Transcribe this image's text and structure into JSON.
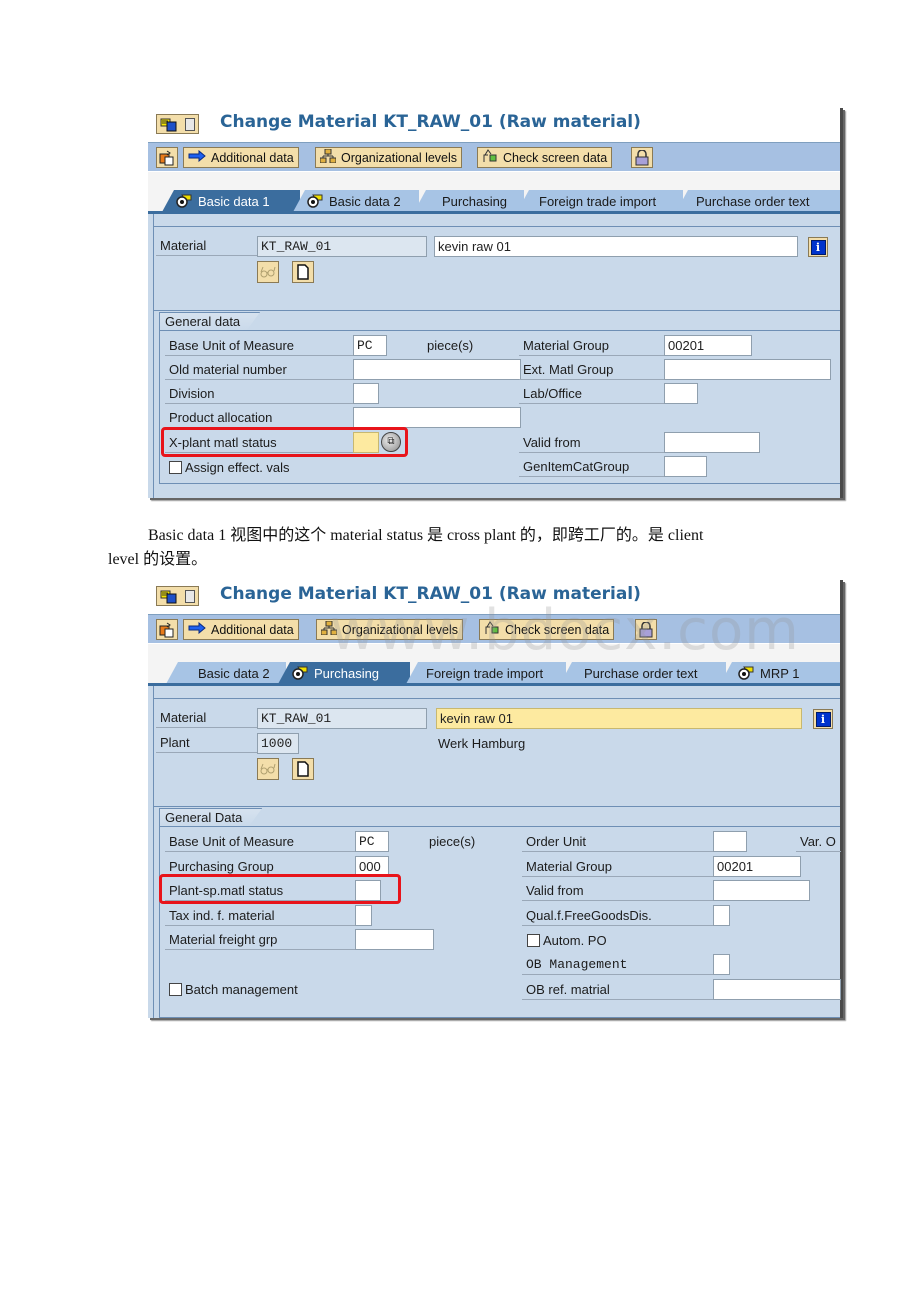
{
  "screenshot1": {
    "title": "Change Material KT_RAW_01 (Raw material)",
    "toolbar": {
      "additional_data": "Additional data",
      "org_levels": "Organizational levels",
      "check_screen_data": "Check screen data"
    },
    "tabs": [
      {
        "label": "Basic data 1",
        "active": true,
        "has_icon": true
      },
      {
        "label": "Basic data 2",
        "active": false,
        "has_icon": true
      },
      {
        "label": "Purchasing",
        "active": false,
        "has_icon": false
      },
      {
        "label": "Foreign trade import",
        "active": false,
        "has_icon": false
      },
      {
        "label": "Purchase order text",
        "active": false,
        "has_icon": false
      }
    ],
    "header": {
      "material_label": "Material",
      "material_value": "KT_RAW_01",
      "description_value": "kevin raw 01"
    },
    "group_title": "General data",
    "left_fields": {
      "base_uom_label": "Base Unit of Measure",
      "base_uom_value": "PC",
      "base_uom_text": "piece(s)",
      "old_material_label": "Old material number",
      "old_material_value": "",
      "division_label": "Division",
      "division_value": "",
      "product_alloc_label": "Product allocation",
      "product_alloc_value": "",
      "xplant_status_label": "X-plant matl status",
      "xplant_status_value": "",
      "assign_effect_label": "Assign effect. vals",
      "assign_effect_checked": false
    },
    "right_fields": {
      "material_group_label": "Material Group",
      "material_group_value": "00201",
      "ext_matl_group_label": "Ext. Matl Group",
      "ext_matl_group_value": "",
      "lab_office_label": "Lab/Office",
      "lab_office_value": "",
      "valid_from_label": "Valid from",
      "valid_from_value": "",
      "gen_item_cat_label": "GenItemCatGroup",
      "gen_item_cat_value": ""
    }
  },
  "paragraph": {
    "line1": "Basic data 1 视图中的这个 material status 是 cross plant 的，即跨工厂的。是 client",
    "line2": "level 的设置。"
  },
  "screenshot2": {
    "title": "Change Material KT_RAW_01 (Raw material)",
    "toolbar": {
      "additional_data": "Additional data",
      "org_levels": "Organizational levels",
      "check_screen_data": "Check screen data"
    },
    "tabs": [
      {
        "label": "Basic data 2",
        "active": false,
        "has_icon": false
      },
      {
        "label": "Purchasing",
        "active": true,
        "has_icon": true
      },
      {
        "label": "Foreign trade import",
        "active": false,
        "has_icon": false
      },
      {
        "label": "Purchase order text",
        "active": false,
        "has_icon": false
      },
      {
        "label": "MRP 1",
        "active": false,
        "has_icon": true
      }
    ],
    "header": {
      "material_label": "Material",
      "material_value": "KT_RAW_01",
      "description_value": "kevin raw 01",
      "plant_label": "Plant",
      "plant_value": "1000",
      "plant_name": "Werk Hamburg"
    },
    "group_title": "General Data",
    "left_fields": {
      "base_uom_label": "Base Unit of Measure",
      "base_uom_value": "PC",
      "base_uom_text": "piece(s)",
      "purch_group_label": "Purchasing Group",
      "purch_group_value": "000",
      "plant_status_label": "Plant-sp.matl status",
      "plant_status_value": "",
      "tax_ind_label": "Tax ind. f. material",
      "tax_ind_value": "",
      "freight_grp_label": "Material freight grp",
      "freight_grp_value": "",
      "batch_mgmt_label": "Batch management",
      "batch_mgmt_checked": false
    },
    "right_fields": {
      "order_unit_label": "Order Unit",
      "order_unit_value": "",
      "var_label": "Var. O",
      "material_group_label": "Material Group",
      "material_group_value": "00201",
      "valid_from_label": "Valid from",
      "valid_from_value": "",
      "qual_free_goods_label": "Qual.f.FreeGoodsDis.",
      "qual_free_goods_value": "",
      "autom_po_label": "Autom. PO",
      "autom_po_checked": false,
      "ob_mgmt_label": "OB Management",
      "ob_mgmt_value": "",
      "ob_ref_label": "OB ref. matrial",
      "ob_ref_value": ""
    }
  },
  "watermark": "www.bdocx.com",
  "colors": {
    "title_blue": "#2a6496",
    "toolbar_bg": "#a6c0e2",
    "tab_active": "#3b6d9e",
    "tab_inactive": "#a7c4e5",
    "panel_bg": "#c9d9ea",
    "button_bg": "#f3deaa",
    "highlight_red": "#e8141b",
    "required_yellow": "#fdeaa0"
  }
}
